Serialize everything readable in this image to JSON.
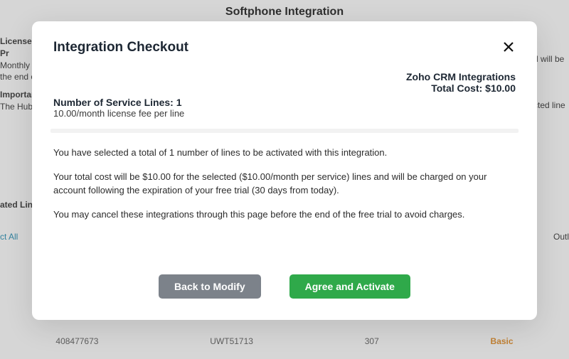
{
  "background": {
    "page_title": "Softphone Integration",
    "license_block": {
      "label": "License Pr",
      "line1": "Monthly li",
      "line2": "the end of"
    },
    "important_block": {
      "label": "Important",
      "line1": "The Hubsp"
    },
    "right_snips": {
      "snippet1": "d will be",
      "snippet2": "cted line"
    },
    "ated_lines_label": "ated Lines",
    "select_all": "ct All",
    "outlook_snip": "Outl",
    "row": {
      "c1": "408477673",
      "c2": "UWT51713",
      "c3": "307",
      "c4": "Basic"
    }
  },
  "modal": {
    "title": "Integration Checkout",
    "product_name": "Zoho CRM Integrations",
    "total_cost_label": "Total Cost: $10.00",
    "lines_label": "Number of Service Lines: 1",
    "fee_label": "10.00/month license fee per line",
    "para1": "You have selected a total of 1 number of lines to be activated with this integration.",
    "para2": "Your total cost will be $10.00 for the selected ($10.00/month per service) lines and will be charged on your account following the expiration of your free trial (30 days from today).",
    "para3": "You may cancel these integrations through this page before the end of the free trial to avoid charges.",
    "back_button": "Back to Modify",
    "agree_button": "Agree and Activate"
  }
}
